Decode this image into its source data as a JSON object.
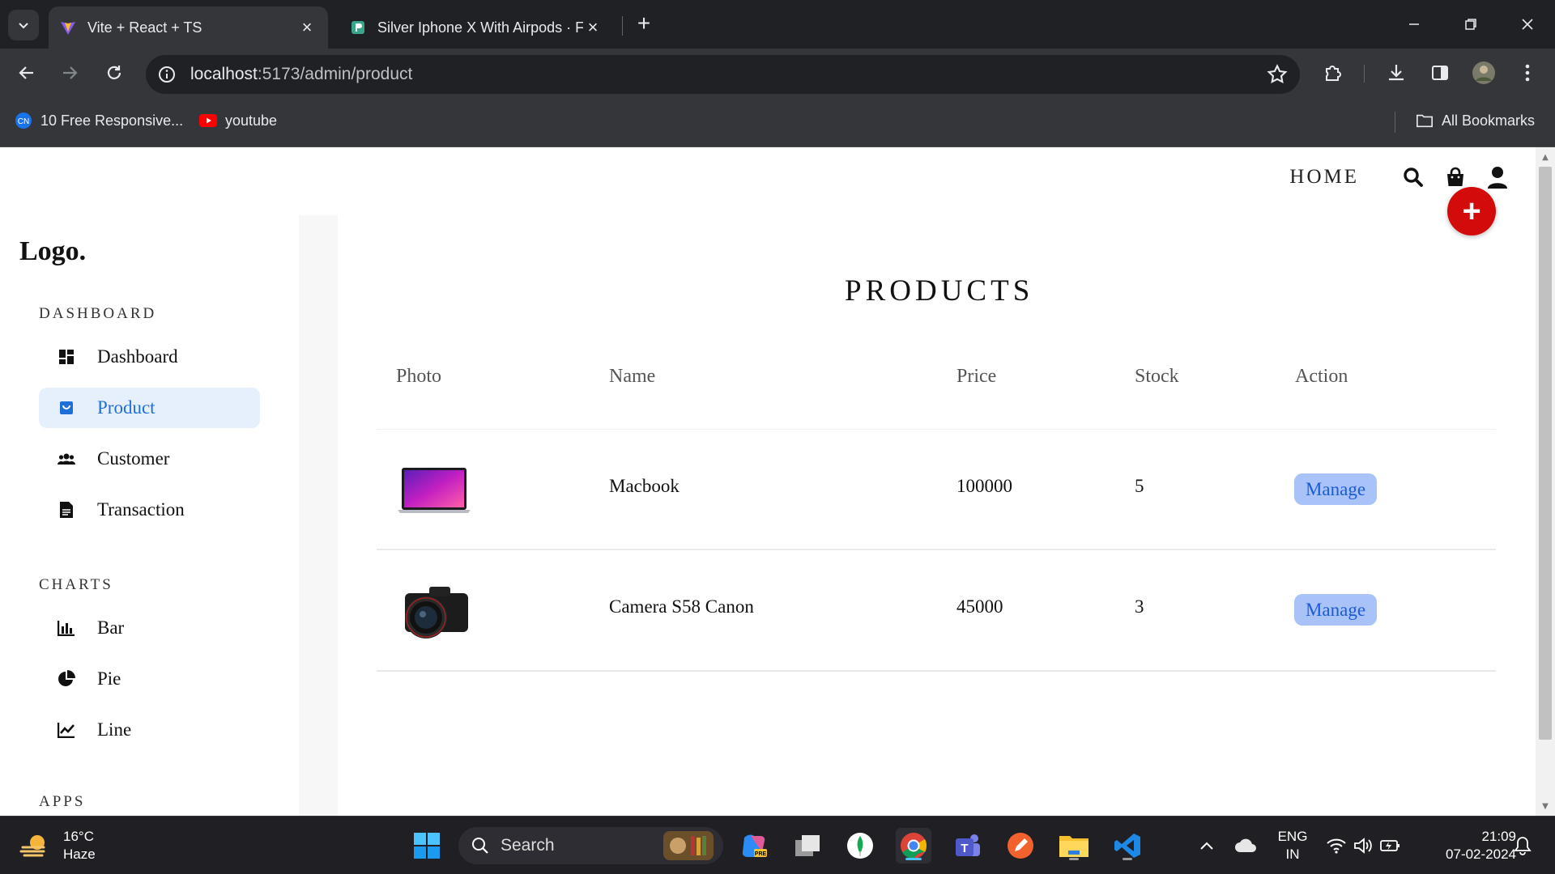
{
  "browser": {
    "tabs": [
      {
        "title": "Vite + React + TS"
      },
      {
        "title": "Silver Iphone X With Airpods · F"
      }
    ],
    "url_host": "localhost",
    "url_path": ":5173/admin/product",
    "bookmarks": [
      {
        "label": "10 Free Responsive..."
      },
      {
        "label": "youtube"
      }
    ],
    "all_bookmarks": "All Bookmarks"
  },
  "header": {
    "home_label": "HOME"
  },
  "fab_label": "+",
  "sidebar": {
    "logo": "Logo.",
    "sections": [
      {
        "title": "DASHBOARD",
        "items": [
          {
            "label": "Dashboard",
            "icon": "dashboard-icon"
          },
          {
            "label": "Product",
            "icon": "bag-icon",
            "active": true
          },
          {
            "label": "Customer",
            "icon": "people-icon"
          },
          {
            "label": "Transaction",
            "icon": "document-icon"
          }
        ]
      },
      {
        "title": "CHARTS",
        "items": [
          {
            "label": "Bar",
            "icon": "bar-chart-icon"
          },
          {
            "label": "Pie",
            "icon": "pie-chart-icon"
          },
          {
            "label": "Line",
            "icon": "line-chart-icon"
          }
        ]
      },
      {
        "title": "APPS",
        "items": []
      }
    ]
  },
  "main": {
    "title": "PRODUCTS",
    "columns": [
      "Photo",
      "Name",
      "Price",
      "Stock",
      "Action"
    ],
    "rows": [
      {
        "photo": "laptop-image",
        "name": "Macbook",
        "price": "100000",
        "stock": "5",
        "action": "Manage"
      },
      {
        "photo": "camera-image",
        "name": "Camera S58 Canon",
        "price": "45000",
        "stock": "3",
        "action": "Manage"
      }
    ]
  },
  "taskbar": {
    "weather_temp": "16°C",
    "weather_desc": "Haze",
    "search_label": "Search",
    "lang_top": "ENG",
    "lang_bottom": "IN",
    "time": "21:09",
    "date": "07-02-2024"
  },
  "colors": {
    "accent": "#1e6fd9",
    "active_bg": "#e6f0fd",
    "fab": "#d30b0b",
    "manage_bg": "#a9c2f7"
  }
}
